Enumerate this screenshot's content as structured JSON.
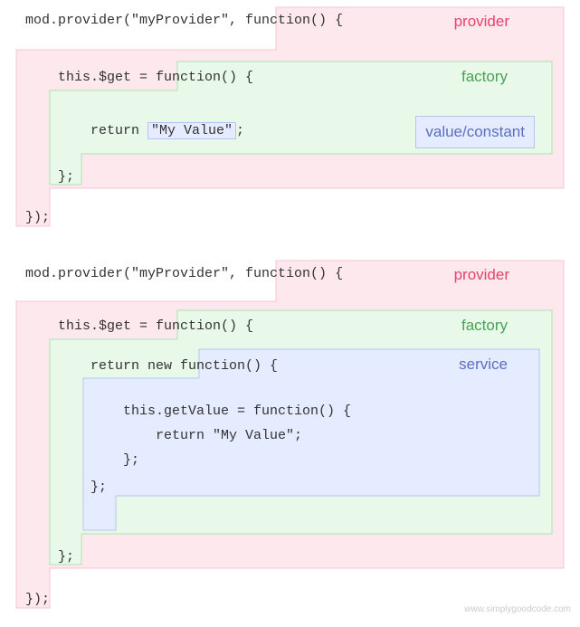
{
  "watermark": "www.simplygoodcode.com",
  "colors": {
    "provider_fill": "#fde8ee",
    "provider_stroke": "#f7c3d0",
    "factory_fill": "#e9f9e9",
    "factory_stroke": "#aee0b2",
    "value_fill": "#e6ecff",
    "value_stroke": "#b7c3f0"
  },
  "labels": {
    "provider": "provider",
    "factory": "factory",
    "value": "value/constant",
    "service": "service"
  },
  "block1": {
    "line1_a": "mod.provider(\"myProvider\",",
    "line1_b": " function() {",
    "line2_a": "    this.$get =",
    "line2_b": " function() {",
    "line3_a": "        return ",
    "line3_val": "\"My Value\"",
    "line3_b": ";",
    "line4": "    };",
    "line5": "});"
  },
  "block2": {
    "line1_a": "mod.provider(\"myProvider\",",
    "line1_b": " function() {",
    "line2_a": "    this.$get =",
    "line2_b": " function() {",
    "line3_a": "        return new",
    "line3_b": " function() {",
    "line4": "            this.getValue = function() {",
    "line5": "                return \"My Value\";",
    "line6": "            };",
    "line7": "        };",
    "line8": "    };",
    "line9": "});"
  }
}
